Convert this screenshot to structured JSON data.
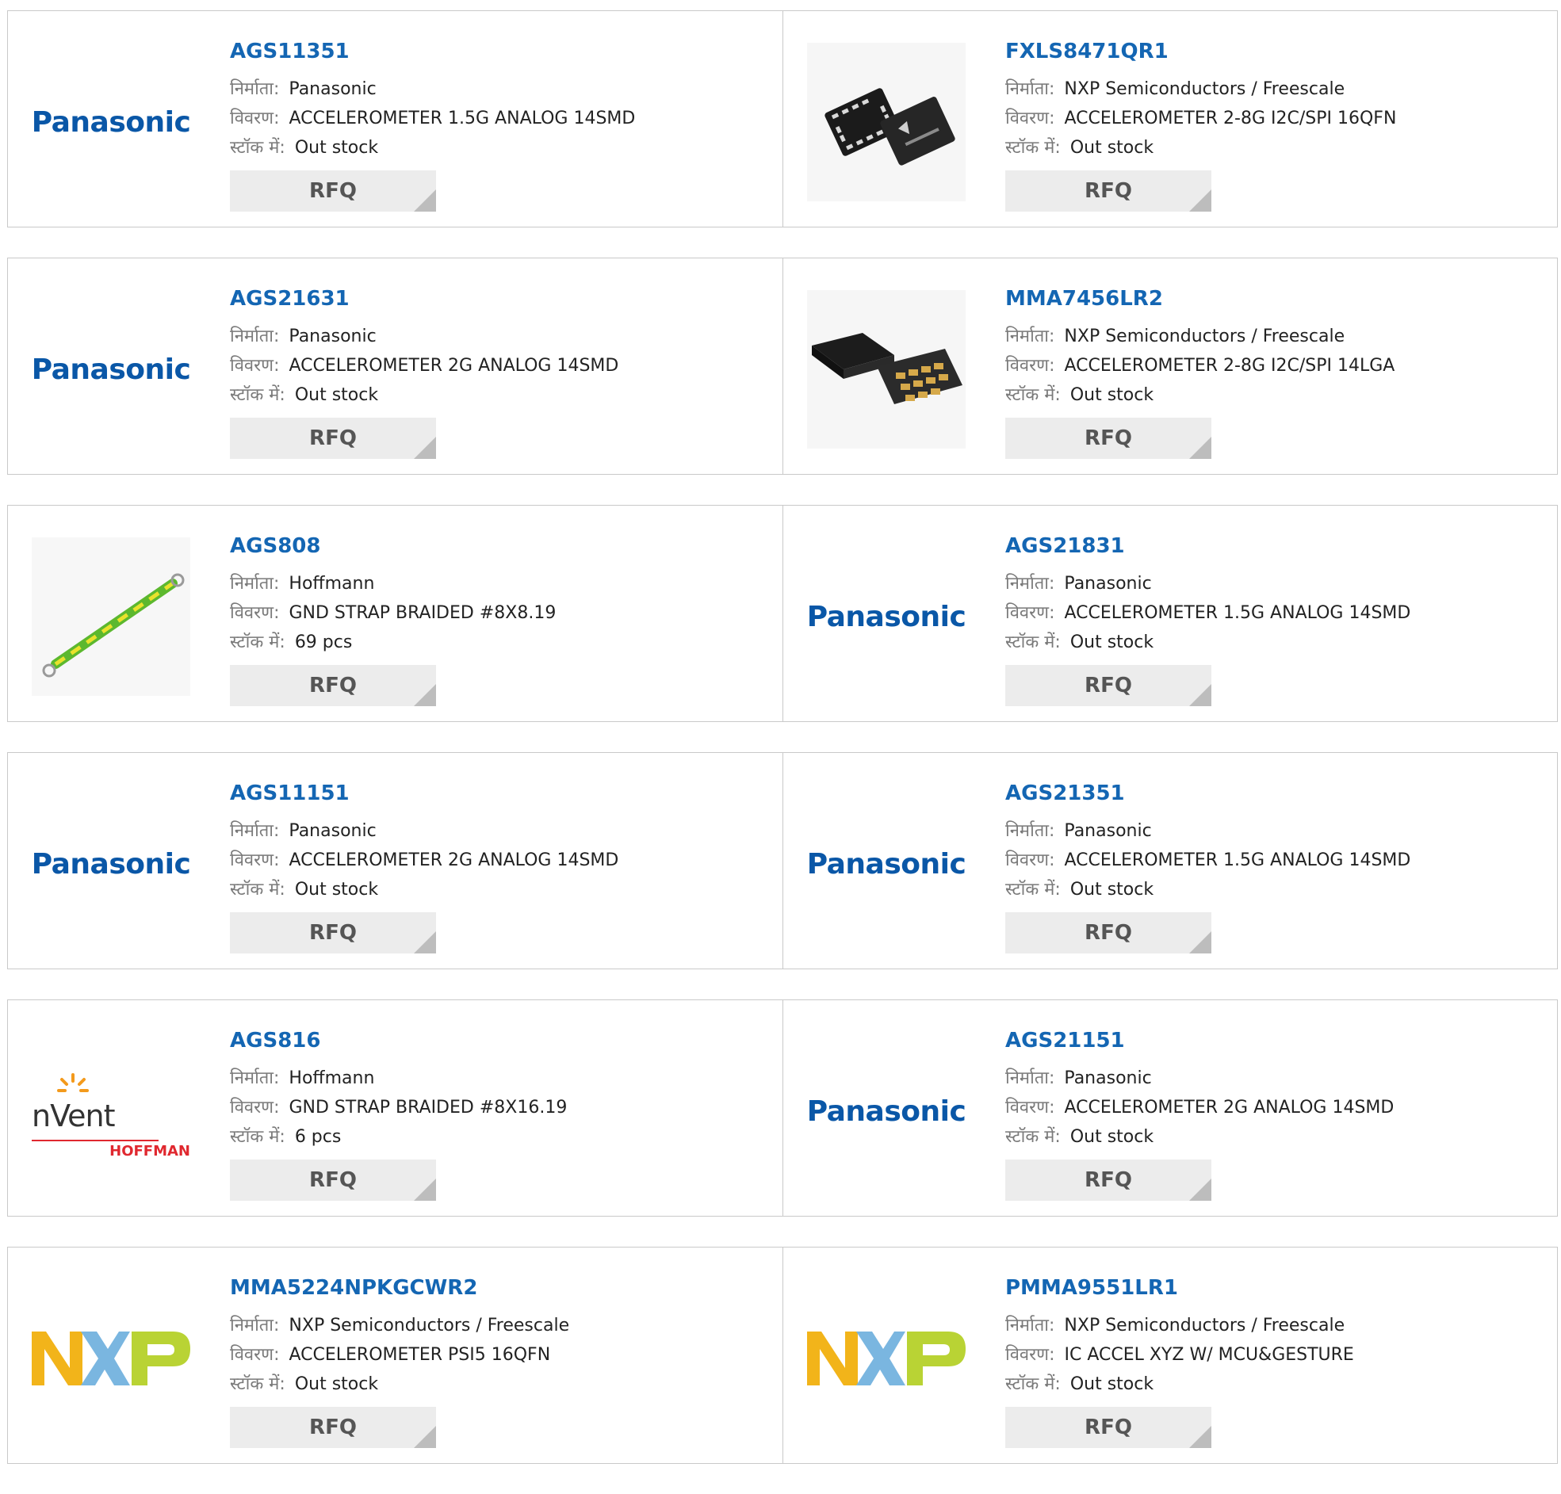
{
  "labels": {
    "manufacturer": "निर्माता:",
    "description": "विवरण:",
    "in_stock": "स्टॉक में:",
    "rfq": "RFQ"
  },
  "products": [
    {
      "part": "AGS11351",
      "manufacturer": "Panasonic",
      "description": "ACCELEROMETER 1.5G ANALOG 14SMD",
      "stock": "Out stock",
      "image": "panasonic-logo"
    },
    {
      "part": "FXLS8471QR1",
      "manufacturer": "NXP Semiconductors / Freescale",
      "description": "ACCELEROMETER 2-8G I2C/SPI 16QFN",
      "stock": "Out stock",
      "image": "qfn-chip-photo"
    },
    {
      "part": "AGS21631",
      "manufacturer": "Panasonic",
      "description": "ACCELEROMETER 2G ANALOG 14SMD",
      "stock": "Out stock",
      "image": "panasonic-logo"
    },
    {
      "part": "MMA7456LR2",
      "manufacturer": "NXP Semiconductors / Freescale",
      "description": "ACCELEROMETER 2-8G I2C/SPI 14LGA",
      "stock": "Out stock",
      "image": "lga-chip-photo"
    },
    {
      "part": "AGS808",
      "manufacturer": "Hoffmann",
      "description": "GND STRAP BRAIDED #8X8.19",
      "stock": "69 pcs",
      "image": "ground-strap-photo"
    },
    {
      "part": "AGS21831",
      "manufacturer": "Panasonic",
      "description": "ACCELEROMETER 1.5G ANALOG 14SMD",
      "stock": "Out stock",
      "image": "panasonic-logo"
    },
    {
      "part": "AGS11151",
      "manufacturer": "Panasonic",
      "description": "ACCELEROMETER 2G ANALOG 14SMD",
      "stock": "Out stock",
      "image": "panasonic-logo"
    },
    {
      "part": "AGS21351",
      "manufacturer": "Panasonic",
      "description": "ACCELEROMETER 1.5G ANALOG 14SMD",
      "stock": "Out stock",
      "image": "panasonic-logo"
    },
    {
      "part": "AGS816",
      "manufacturer": "Hoffmann",
      "description": "GND STRAP BRAIDED #8X16.19",
      "stock": "6 pcs",
      "image": "nvent-hoffman-logo"
    },
    {
      "part": "AGS21151",
      "manufacturer": "Panasonic",
      "description": "ACCELEROMETER 2G ANALOG 14SMD",
      "stock": "Out stock",
      "image": "panasonic-logo"
    },
    {
      "part": "MMA5224NPKGCWR2",
      "manufacturer": "NXP Semiconductors / Freescale",
      "description": "ACCELEROMETER PSI5 16QFN",
      "stock": "Out stock",
      "image": "nxp-logo"
    },
    {
      "part": "PMMA9551LR1",
      "manufacturer": "NXP Semiconductors / Freescale",
      "description": "IC ACCEL XYZ W/ MCU&GESTURE",
      "stock": "Out stock",
      "image": "nxp-logo"
    }
  ],
  "logos": {
    "panasonic_text": "Panasonic",
    "nvent_text": "nVent",
    "hoffman_text": "HOFFMAN"
  },
  "colors": {
    "link": "#1466b3",
    "label": "#7a7a7a",
    "button_bg": "#ececec",
    "border": "#c9c9c9",
    "panasonic_blue": "#0a57a7",
    "hoffman_red": "#e0282f"
  }
}
